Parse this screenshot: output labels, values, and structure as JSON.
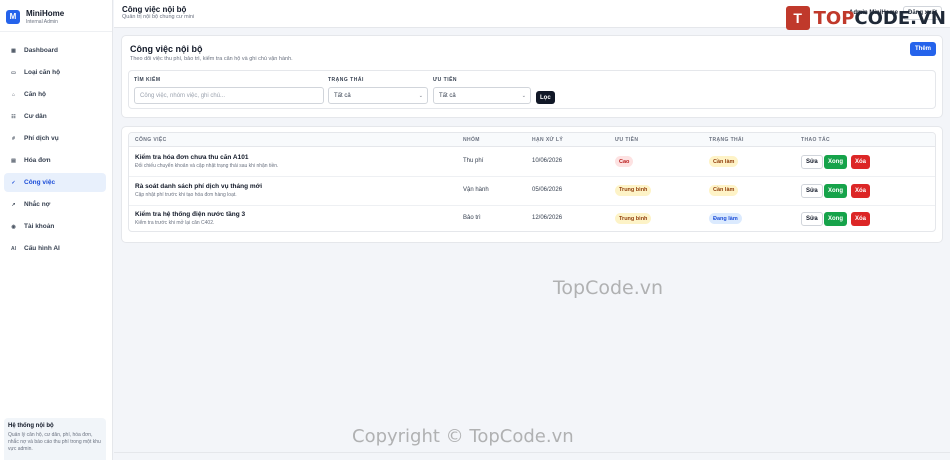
{
  "brand": {
    "logo_letter": "M",
    "name": "MiniHome",
    "subtitle": "Internal Admin"
  },
  "sidebar": {
    "items": [
      {
        "label": "Dashboard",
        "icon": "dashboard-icon",
        "glyph": "▦",
        "active": false
      },
      {
        "label": "Loại căn hộ",
        "icon": "apartment-type-icon",
        "glyph": "▭",
        "active": false
      },
      {
        "label": "Căn hộ",
        "icon": "home-icon",
        "glyph": "⌂",
        "active": false
      },
      {
        "label": "Cư dân",
        "icon": "residents-icon",
        "glyph": "☷",
        "active": false
      },
      {
        "label": "Phí dịch vụ",
        "icon": "fee-icon",
        "glyph": "#",
        "active": false
      },
      {
        "label": "Hóa đơn",
        "icon": "invoice-icon",
        "glyph": "▤",
        "active": false
      },
      {
        "label": "Công việc",
        "icon": "task-check-icon",
        "glyph": "✓",
        "active": true
      },
      {
        "label": "Nhắc nợ",
        "icon": "reminder-icon",
        "glyph": "↗",
        "active": false
      },
      {
        "label": "Tài khoản",
        "icon": "account-icon",
        "glyph": "◉",
        "active": false
      },
      {
        "label": "Cấu hình AI",
        "icon": "ai-config-icon",
        "glyph": "AI",
        "active": false
      }
    ],
    "footer": {
      "title": "Hệ thống nội bộ",
      "description": "Quản lý căn hộ, cư dân, phí, hóa đơn, nhắc nợ và báo cáo thu phí trong một khu vực admin."
    }
  },
  "header": {
    "title": "Công việc nội bộ",
    "subtitle": "Quản trị nội bộ chung cư mini",
    "user": "Admin MiniHome",
    "logout_label": "Đăng xuất"
  },
  "panel": {
    "title": "Công việc nội bộ",
    "subtitle": "Theo dõi việc thu phí, bảo trì, kiểm tra căn hộ và ghi chú vận hành.",
    "add_label": "Thêm"
  },
  "filters": {
    "search_label": "TÌM KIẾM",
    "search_placeholder": "Công việc, nhóm việc, ghi chú...",
    "status_label": "TRẠNG THÁI",
    "status_value": "Tất cả",
    "priority_label": "ƯU TIÊN",
    "priority_value": "Tất cả",
    "filter_button": "Lọc"
  },
  "table": {
    "columns": [
      "CÔNG VIỆC",
      "NHÓM",
      "HẠN XỬ LÝ",
      "ƯU TIÊN",
      "TRẠNG THÁI",
      "THAO TÁC"
    ],
    "actions": {
      "edit": "Sửa",
      "done": "Xong",
      "delete": "Xóa"
    },
    "rows": [
      {
        "title": "Kiểm tra hóa đơn chưa thu căn A101",
        "note": "Đối chiếu chuyển khoản và cập nhật trạng thái sau khi nhận tiền.",
        "group": "Thu phí",
        "due": "10/06/2026",
        "priority": "Cao",
        "status": "Cần làm"
      },
      {
        "title": "Rà soát danh sách phí dịch vụ tháng mới",
        "note": "Cập nhật phí trước khi tạo hóa đơn hàng loạt.",
        "group": "Vận hành",
        "due": "05/06/2026",
        "priority": "Trung bình",
        "status": "Cần làm"
      },
      {
        "title": "Kiểm tra hệ thống điện nước tầng 3",
        "note": "Kiểm tra trước khi mở lại căn C402.",
        "group": "Bảo trì",
        "due": "12/06/2026",
        "priority": "Trung bình",
        "status": "Đang làm"
      }
    ]
  },
  "colors": {
    "accent": "#2563eb",
    "priority_high_bg": "#fde2e2",
    "priority_high_fg": "#b91c1c",
    "priority_mid_bg": "#fdf3c7",
    "priority_mid_fg": "#92400e",
    "status_todo_bg": "#fef3c7",
    "status_todo_fg": "#92400e",
    "status_doing_bg": "#dbeafe",
    "status_doing_fg": "#1d4ed8"
  },
  "watermarks": {
    "logo_icon": "T",
    "logo_text_a": "TOP",
    "logo_text_b": "CODE.VN",
    "center": "TopCode.vn",
    "bottom": "Copyright © TopCode.vn"
  }
}
